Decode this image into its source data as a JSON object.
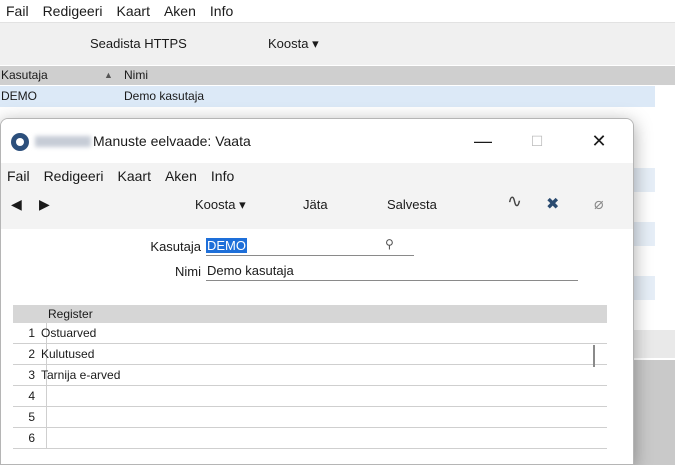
{
  "main": {
    "menu": [
      "Fail",
      "Redigeeri",
      "Kaart",
      "Aken",
      "Info"
    ],
    "toolbar": {
      "https": "Seadista HTTPS",
      "create": "Koosta ▾"
    },
    "columns": {
      "user": "Kasutaja",
      "sort_icon": "▲",
      "name": "Nimi"
    },
    "row": {
      "user": "DEMO",
      "name": "Demo kasutaja"
    }
  },
  "dialog": {
    "title": "Manuste eelvaade: Vaata",
    "window_controls": {
      "minimize": "—",
      "maximize": "☐",
      "close": "✕"
    },
    "menu": [
      "Fail",
      "Redigeeri",
      "Kaart",
      "Aken",
      "Info"
    ],
    "toolbar": {
      "prev": "◀",
      "next": "▶",
      "create": "Koosta ▾",
      "leave": "Jäta",
      "save": "Salvesta",
      "icons": {
        "activity": "∿",
        "expand": "✖",
        "attach": "⌀"
      }
    },
    "form": {
      "user_label": "Kasutaja",
      "user_value": "DEMO",
      "name_label": "Nimi",
      "name_value": "Demo kasutaja",
      "lookup_icon": "⚲"
    },
    "grid": {
      "header": "Register",
      "rows": [
        {
          "n": "1",
          "text": "Ostuarved"
        },
        {
          "n": "2",
          "text": "Kulutused"
        },
        {
          "n": "3",
          "text": "Tarnija e-arved"
        },
        {
          "n": "4",
          "text": ""
        },
        {
          "n": "5",
          "text": ""
        },
        {
          "n": "6",
          "text": ""
        }
      ]
    }
  }
}
